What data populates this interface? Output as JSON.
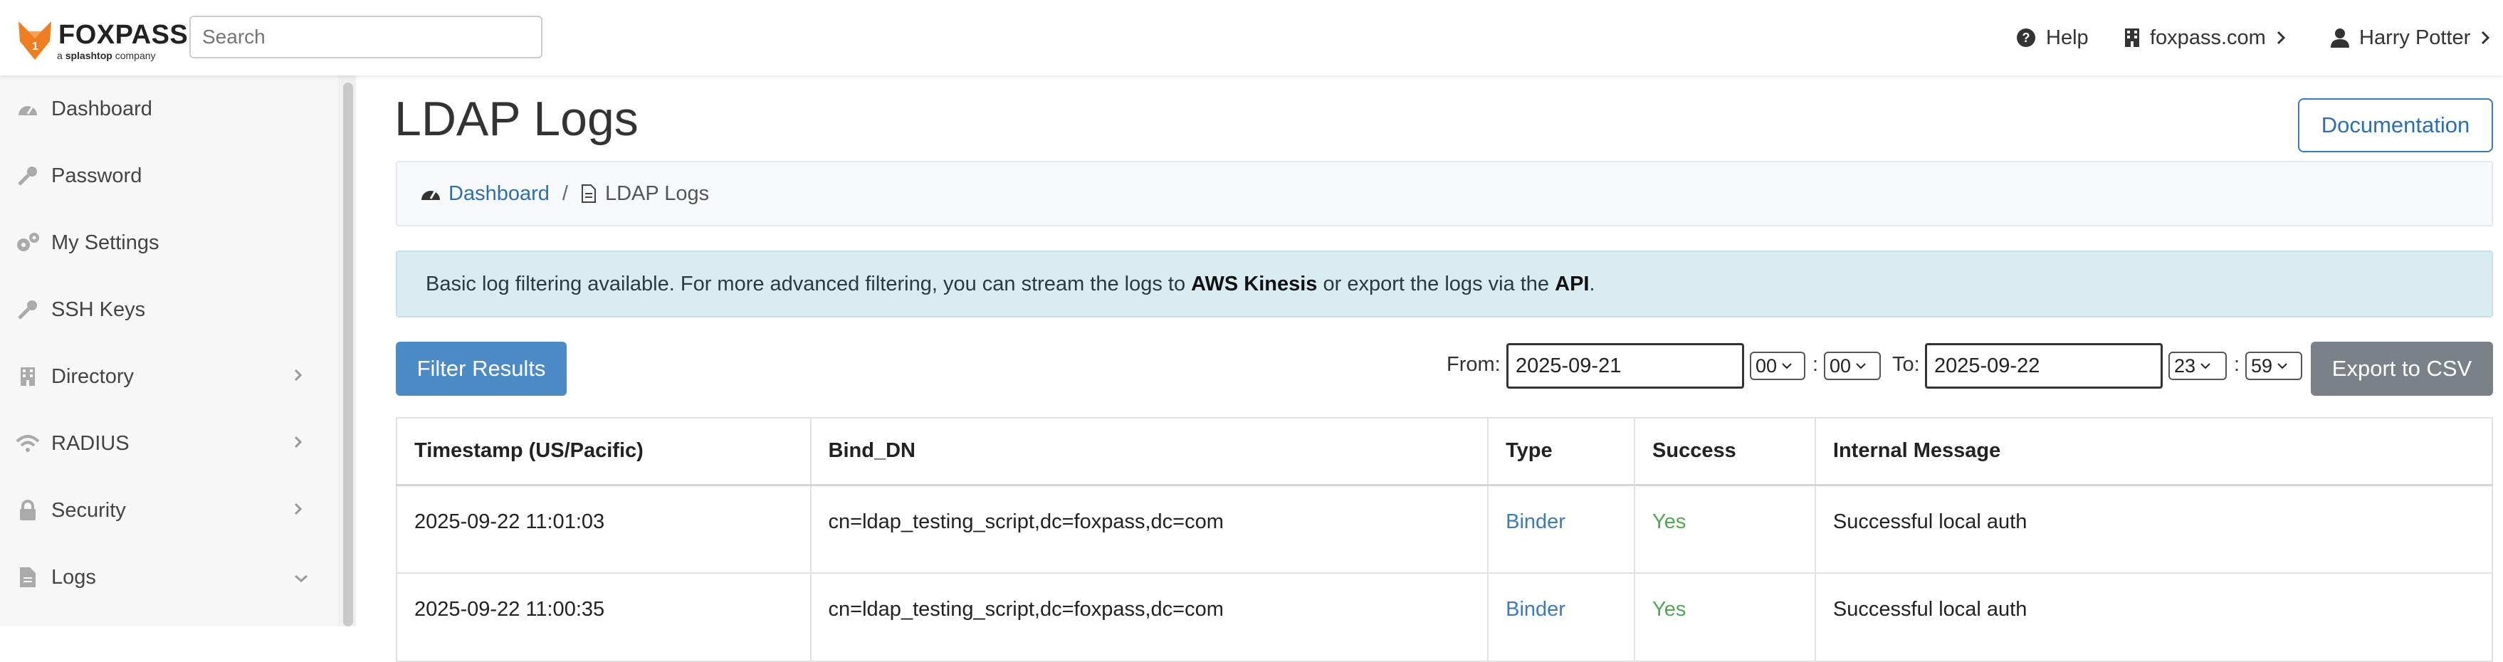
{
  "brand": {
    "name": "FOXPASS",
    "tagline_prefix": "a",
    "tagline_brand": "splashtop",
    "tagline_suffix": "company",
    "color": "#ef7d22"
  },
  "search": {
    "placeholder": "Search",
    "value": ""
  },
  "topnav": {
    "help": "Help",
    "org": "foxpass.com",
    "user": "Harry Potter"
  },
  "sidebar": {
    "items": [
      {
        "label": "Dashboard",
        "icon": "dashboard-icon",
        "expandable": false
      },
      {
        "label": "Password",
        "icon": "key-icon",
        "expandable": false
      },
      {
        "label": "My Settings",
        "icon": "gears-icon",
        "expandable": false
      },
      {
        "label": "SSH Keys",
        "icon": "key-icon",
        "expandable": false
      },
      {
        "label": "Directory",
        "icon": "building-icon",
        "expandable": true,
        "expanded": false
      },
      {
        "label": "RADIUS",
        "icon": "wifi-icon",
        "expandable": true,
        "expanded": false
      },
      {
        "label": "Security",
        "icon": "lock-icon",
        "expandable": true,
        "expanded": false
      },
      {
        "label": "Logs",
        "icon": "file-icon",
        "expandable": true,
        "expanded": true
      }
    ]
  },
  "page": {
    "title": "LDAP Logs",
    "documentation_label": "Documentation",
    "breadcrumb": {
      "home": "Dashboard",
      "separator": "/",
      "current": "LDAP Logs"
    },
    "alert": {
      "text_before": "Basic log filtering available. For more advanced filtering, you can stream the logs to ",
      "link1": "AWS Kinesis",
      "text_middle": " or export the logs via the ",
      "link2": "API",
      "text_after": "."
    },
    "filter": {
      "button": "Filter Results",
      "from_label": "From:",
      "from_date": "2025-09-21",
      "from_hour": "00",
      "from_minute": "00",
      "to_label": "To:",
      "to_date": "2025-09-22",
      "to_hour": "23",
      "to_minute": "59",
      "colon": ":",
      "export_button": "Export to CSV"
    }
  },
  "table": {
    "headers": [
      "Timestamp (US/Pacific)",
      "Bind_DN",
      "Type",
      "Success",
      "Internal Message"
    ],
    "rows": [
      {
        "timestamp": "2025-09-22 11:01:03",
        "bind_dn": "cn=ldap_testing_script,dc=foxpass,dc=com",
        "type": "Binder",
        "success": "Yes",
        "message": "Successful local auth"
      },
      {
        "timestamp": "2025-09-22 11:00:35",
        "bind_dn": "cn=ldap_testing_script,dc=foxpass,dc=com",
        "type": "Binder",
        "success": "Yes",
        "message": "Successful local auth"
      }
    ]
  },
  "colors": {
    "primary": "#4d8bc7",
    "link": "#3d7ab8",
    "success": "#52a852",
    "alert_bg": "#d9ecf2",
    "export_btn": "#7c8187"
  }
}
